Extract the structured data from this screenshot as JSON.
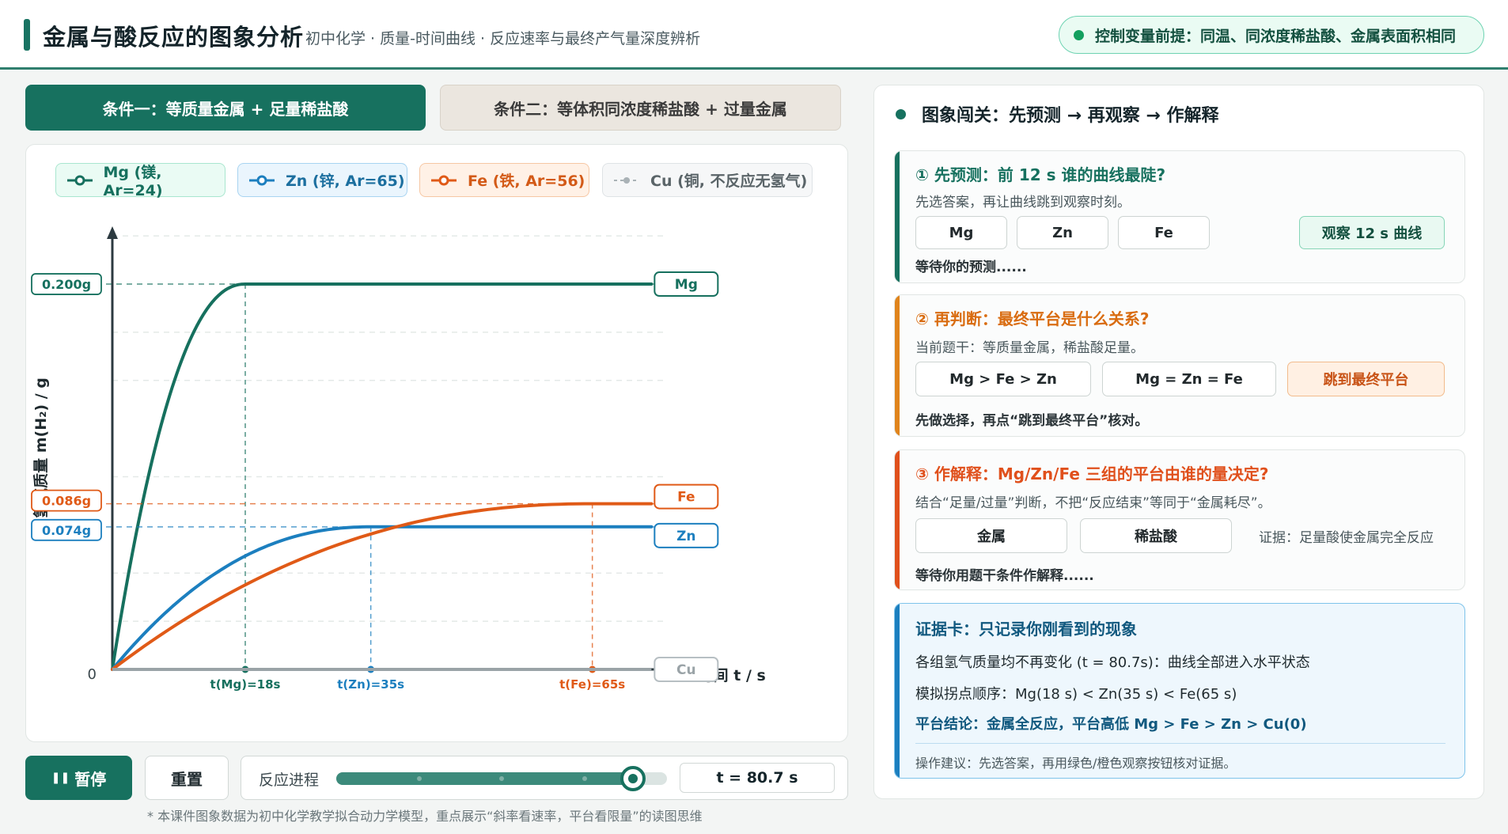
{
  "header": {
    "title": "金属与酸反应的图象分析",
    "subtitle": "初中化学 · 质量-时间曲线 · 反应速率与最终产气量深度辨析",
    "premise": "控制变量前提：同温、同浓度稀盐酸、金属表面积相同"
  },
  "tabs": [
    {
      "label": "条件一：等质量金属 + 足量稀盐酸",
      "active": true
    },
    {
      "label": "条件二：等体积同浓度稀盐酸 + 过量金属",
      "active": false
    }
  ],
  "legend": [
    {
      "label": "Mg (镁, Ar=24)",
      "color": "#16705e"
    },
    {
      "label": "Zn (锌, Ar=65)",
      "color": "#1c7fbf"
    },
    {
      "label": "Fe (铁, Ar=56)",
      "color": "#e05a17"
    },
    {
      "label": "Cu (铜, 不反应无氢气)",
      "color": "#9aa3a7"
    }
  ],
  "chart_data": {
    "type": "line",
    "ylabel": "氢气质量 m(H₂) / g",
    "xlabel": "时间 t / s",
    "origin_label": "0",
    "xlim": [
      0,
      90
    ],
    "ylim": [
      0,
      0.23
    ],
    "series": [
      {
        "name": "Mg",
        "color": "#16705e",
        "tplateau": 18,
        "ymax": 0.2,
        "plateau_label": "0.200g",
        "t_label": "t(Mg)=18s"
      },
      {
        "name": "Zn",
        "color": "#1c7fbf",
        "tplateau": 35,
        "ymax": 0.074,
        "plateau_label": "0.074g",
        "t_label": "t(Zn)=35s"
      },
      {
        "name": "Fe",
        "color": "#e05a17",
        "tplateau": 65,
        "ymax": 0.086,
        "plateau_label": "0.086g",
        "t_label": "t(Fe)=65s"
      },
      {
        "name": "Cu",
        "color": "#9aa3a7",
        "tplateau": 0,
        "ymax": 0,
        "plateau_label": "",
        "t_label": ""
      }
    ]
  },
  "controls": {
    "pause_label": "暂停",
    "reset_label": "重置",
    "progress_label": "反应进程",
    "progress": 0.897,
    "time_readout": "t = 80.7 s"
  },
  "footnote": "* 本课件图象数据为初中化学教学拟合动力学模型，重点展示“斜率看速率，平台看限量”的读图思维",
  "right": {
    "title": "图象闯关：先预测 → 再观察 → 作解释",
    "card1": {
      "title": "① 先预测：前 12 s 谁的曲线最陡?",
      "desc": "先选答案，再让曲线跳到观察时刻。",
      "choices": [
        "Mg",
        "Zn",
        "Fe"
      ],
      "action": "观察 12 s 曲线",
      "status": "等待你的预测......"
    },
    "card2": {
      "title": "② 再判断：最终平台是什么关系?",
      "desc": "当前题干：等质量金属，稀盐酸足量。",
      "choices": [
        "Mg > Fe > Zn",
        "Mg = Zn = Fe"
      ],
      "action": "跳到最终平台",
      "status": "先做选择，再点“跳到最终平台”核对。"
    },
    "card3": {
      "title": "③ 作解释：Mg/Zn/Fe 三组的平台由谁的量决定?",
      "desc": "结合“足量/过量”判断，不把“反应结束”等同于“金属耗尽”。",
      "choices": [
        "金属",
        "稀盐酸"
      ],
      "evidence": "证据：足量酸使金属完全反应",
      "status": "等待你用题干条件作解释......"
    },
    "card4": {
      "title": "证据卡：只记录你刚看到的现象",
      "line1": "各组氢气质量均不再变化 (t = 80.7s)：曲线全部进入水平状态",
      "line2": "模拟拐点顺序：Mg(18 s) < Zn(35 s) < Fe(65 s)",
      "line3": "平台结论：金属全反应，平台高低 Mg > Fe > Zn > Cu(0)",
      "tip": "操作建议：先选答案，再用绿色/橙色观察按钮核对证据。"
    }
  }
}
